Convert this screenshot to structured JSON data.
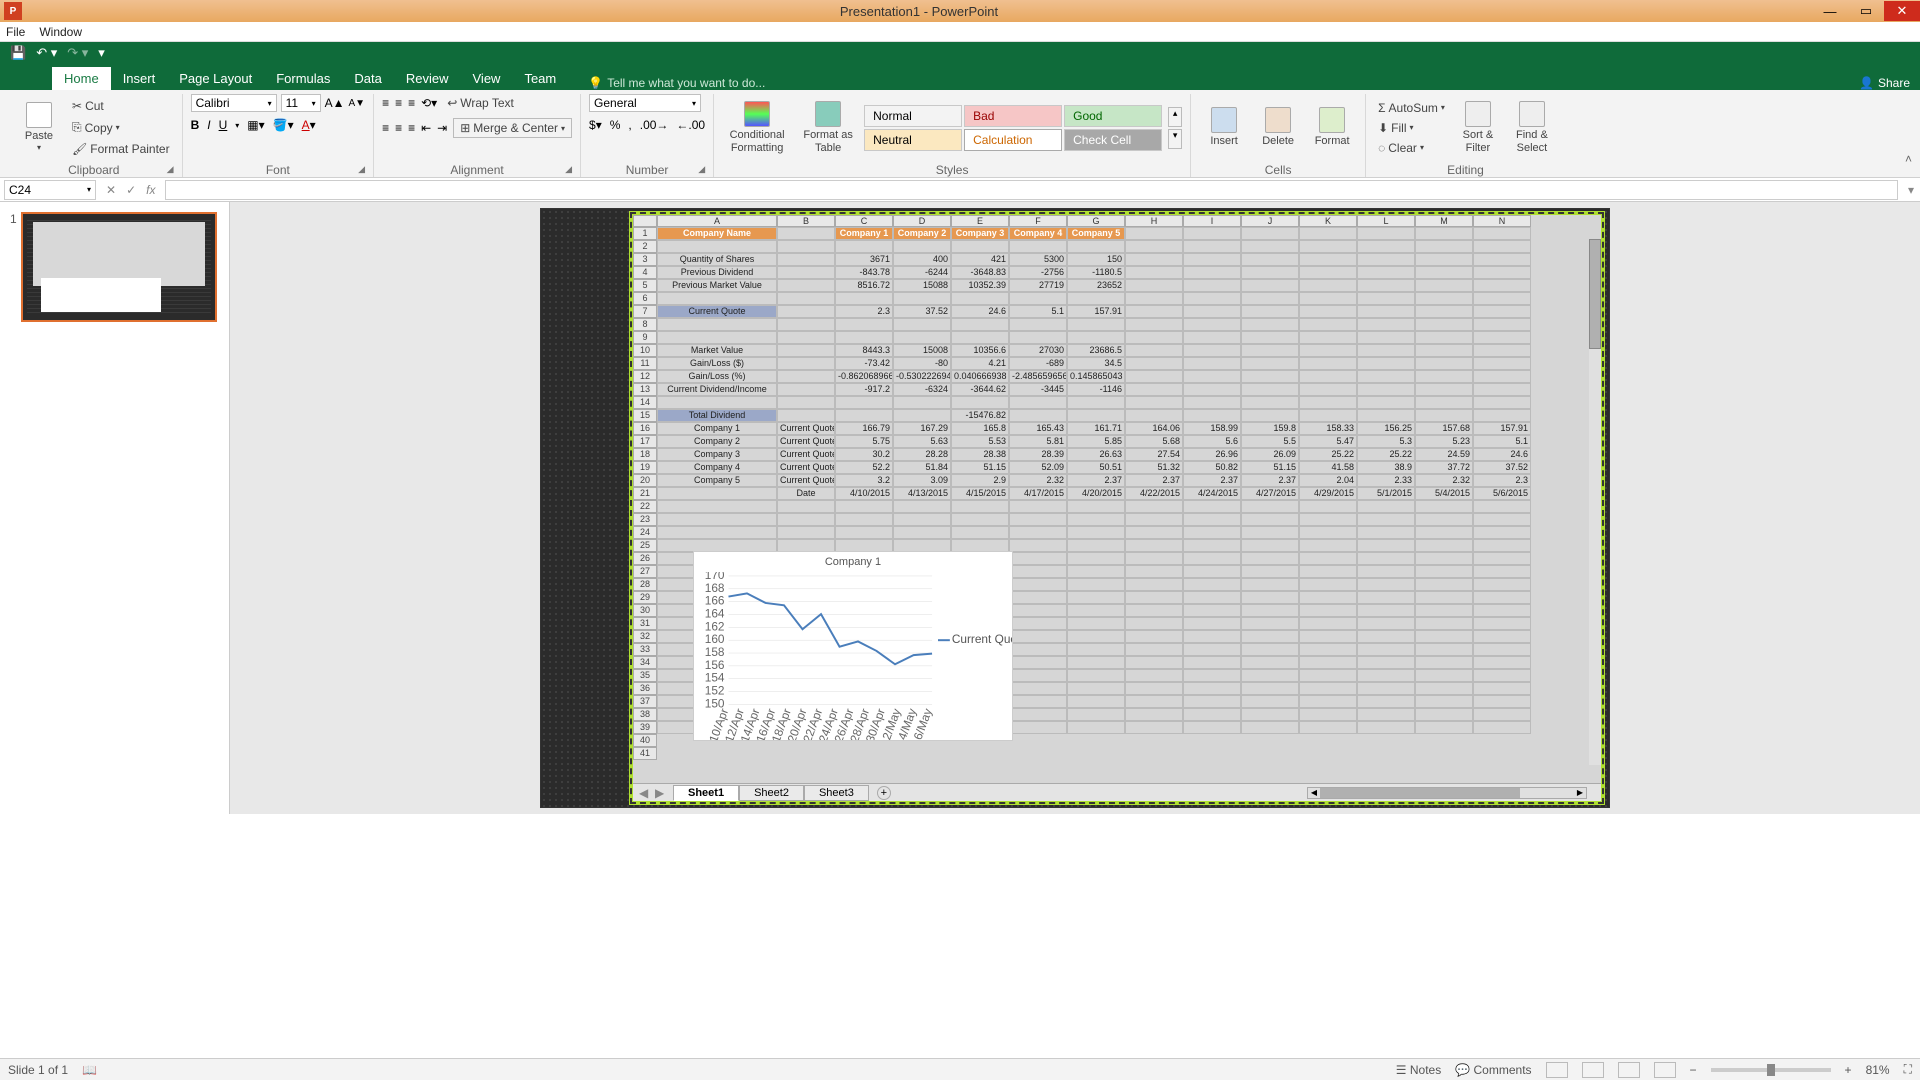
{
  "title": "Presentation1 - PowerPoint",
  "menu": {
    "file": "File",
    "window": "Window"
  },
  "tabs": {
    "home": "Home",
    "insert": "Insert",
    "pagelayout": "Page Layout",
    "formulas": "Formulas",
    "data": "Data",
    "review": "Review",
    "view": "View",
    "team": "Team"
  },
  "tellme": "Tell me what you want to do...",
  "share": "Share",
  "ribbon": {
    "clipboard": {
      "paste": "Paste",
      "cut": "Cut",
      "copy": "Copy",
      "painter": "Format Painter",
      "label": "Clipboard"
    },
    "font": {
      "name": "Calibri",
      "size": "11",
      "label": "Font"
    },
    "alignment": {
      "wrap": "Wrap Text",
      "merge": "Merge & Center",
      "label": "Alignment"
    },
    "number": {
      "fmt": "General",
      "label": "Number"
    },
    "styles": {
      "cond": "Conditional Formatting",
      "fmtastable": "Format as Table",
      "normal": "Normal",
      "bad": "Bad",
      "good": "Good",
      "neutral": "Neutral",
      "calc": "Calculation",
      "check": "Check Cell",
      "label": "Styles"
    },
    "cells": {
      "insert": "Insert",
      "delete": "Delete",
      "format": "Format",
      "label": "Cells"
    },
    "editing": {
      "autosum": "AutoSum",
      "fill": "Fill",
      "clear": "Clear",
      "sort": "Sort & Filter",
      "find": "Find & Select",
      "label": "Editing"
    }
  },
  "namebox": "C24",
  "slideIndicator": "Slide 1 of 1",
  "notesBtn": "Notes",
  "commentsBtn": "Comments",
  "zoom": "81%",
  "thumbNum": "1",
  "sheetTabs": [
    "Sheet1",
    "Sheet2",
    "Sheet3"
  ],
  "cols": [
    "A",
    "B",
    "C",
    "D",
    "E",
    "F",
    "G",
    "H",
    "I",
    "J",
    "K",
    "L",
    "M",
    "N"
  ],
  "rowNums": [
    1,
    2,
    3,
    4,
    5,
    6,
    7,
    8,
    9,
    10,
    11,
    12,
    13,
    14,
    15,
    16,
    17,
    18,
    19,
    20,
    21,
    22,
    23,
    24,
    25,
    26,
    27,
    28,
    29,
    30,
    31,
    32,
    33,
    34,
    35,
    36,
    37,
    38,
    39,
    40,
    41
  ],
  "sheet": {
    "companyName": "Company Name",
    "headers": [
      "Company 1",
      "Company 2",
      "Company 3",
      "Company 4",
      "Company 5"
    ],
    "rows": [
      {
        "lbl": "Quantity of Shares",
        "v": [
          "3671",
          "400",
          "421",
          "5300",
          "150"
        ]
      },
      {
        "lbl": "Previous Dividend",
        "v": [
          "-843.78",
          "-6244",
          "-3648.83",
          "-2756",
          "-1180.5"
        ]
      },
      {
        "lbl": "Previous Market Value",
        "v": [
          "8516.72",
          "15088",
          "10352.39",
          "27719",
          "23652"
        ]
      },
      {
        "lbl": ""
      },
      {
        "lbl": "Current Quote",
        "hdr": true,
        "v": [
          "2.3",
          "37.52",
          "24.6",
          "5.1",
          "157.91"
        ]
      },
      {
        "lbl": ""
      },
      {
        "lbl": ""
      },
      {
        "lbl": "Market Value",
        "v": [
          "8443.3",
          "15008",
          "10356.6",
          "27030",
          "23686.5"
        ]
      },
      {
        "lbl": "Gain/Loss ($)",
        "v": [
          "-73.42",
          "-80",
          "4.21",
          "-689",
          "34.5"
        ]
      },
      {
        "lbl": "Gain/Loss (%)",
        "v": [
          "-0.862068966",
          "-0.530222694",
          "0.040666938",
          "-2.485659656",
          "0.145865043"
        ]
      },
      {
        "lbl": "Current Dividend/Income",
        "v": [
          "-917.2",
          "-6324",
          "-3644.62",
          "-3445",
          "-1146"
        ]
      },
      {
        "lbl": ""
      },
      {
        "lbl": "Total Dividend",
        "hdr": true,
        "v": [
          "",
          "",
          "-15476.82",
          "",
          ""
        ]
      }
    ],
    "quoteLbl": "Current Quote",
    "quotes": [
      {
        "c": "Company 1",
        "v": [
          "166.79",
          "167.29",
          "165.8",
          "165.43",
          "161.71",
          "164.06",
          "158.99",
          "159.8",
          "158.33",
          "156.25",
          "157.68",
          "157.91"
        ]
      },
      {
        "c": "Company 2",
        "v": [
          "5.75",
          "5.63",
          "5.53",
          "5.81",
          "5.85",
          "5.68",
          "5.6",
          "5.5",
          "5.47",
          "5.3",
          "5.23",
          "5.1"
        ]
      },
      {
        "c": "Company 3",
        "v": [
          "30.2",
          "28.28",
          "28.38",
          "28.39",
          "26.63",
          "27.54",
          "26.96",
          "26.09",
          "25.22",
          "25.22",
          "24.59",
          "24.6"
        ]
      },
      {
        "c": "Company 4",
        "v": [
          "52.2",
          "51.84",
          "51.15",
          "52.09",
          "50.51",
          "51.32",
          "50.82",
          "51.15",
          "41.58",
          "38.9",
          "37.72",
          "37.52"
        ]
      },
      {
        "c": "Company 5",
        "v": [
          "3.2",
          "3.09",
          "2.9",
          "2.32",
          "2.37",
          "2.37",
          "2.37",
          "2.37",
          "2.04",
          "2.33",
          "2.32",
          "2.3"
        ]
      }
    ],
    "dateLbl": "Date",
    "dates": [
      "4/10/2015",
      "4/13/2015",
      "4/15/2015",
      "4/17/2015",
      "4/20/2015",
      "4/22/2015",
      "4/24/2015",
      "4/27/2015",
      "4/29/2015",
      "5/1/2015",
      "5/4/2015",
      "5/6/2015"
    ]
  },
  "chart_data": {
    "type": "line",
    "title": "Company 1",
    "legend": "Current Quote",
    "ylim": [
      150,
      170
    ],
    "yticks": [
      150,
      152,
      154,
      156,
      158,
      160,
      162,
      164,
      166,
      168,
      170
    ],
    "x": [
      "10/Apr",
      "12/Apr",
      "14/Apr",
      "16/Apr",
      "18/Apr",
      "20/Apr",
      "22/Apr",
      "24/Apr",
      "26/Apr",
      "28/Apr",
      "30/Apr",
      "2/May",
      "4/May",
      "6/May"
    ],
    "series": [
      {
        "name": "Current Quote",
        "values": [
          166.79,
          167.29,
          165.8,
          165.43,
          161.71,
          164.06,
          158.99,
          159.8,
          158.33,
          156.25,
          157.68,
          157.91
        ]
      }
    ]
  }
}
